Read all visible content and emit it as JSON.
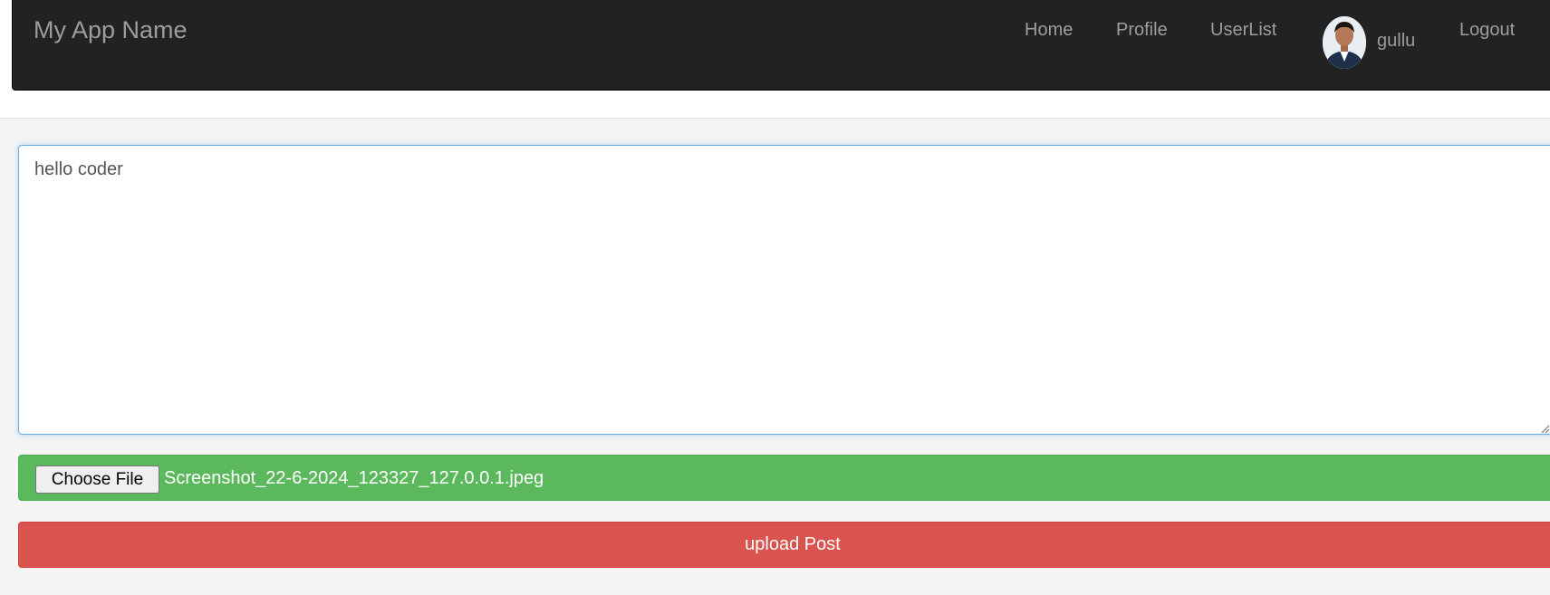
{
  "navbar": {
    "brand": "My App Name",
    "links": [
      "Home",
      "Profile",
      "UserList"
    ],
    "username": "gullu",
    "logout": "Logout"
  },
  "post_form": {
    "text_value": "hello coder",
    "choose_file_label": "Choose File",
    "file_name": "Screenshot_22-6-2024_123327_127.0.0.1.jpeg",
    "upload_label": "upload Post"
  },
  "colors": {
    "navbar_bg": "#222222",
    "file_row_bg": "#5cb85c",
    "upload_bg": "#d9534f",
    "focus_border": "#66afe9"
  }
}
